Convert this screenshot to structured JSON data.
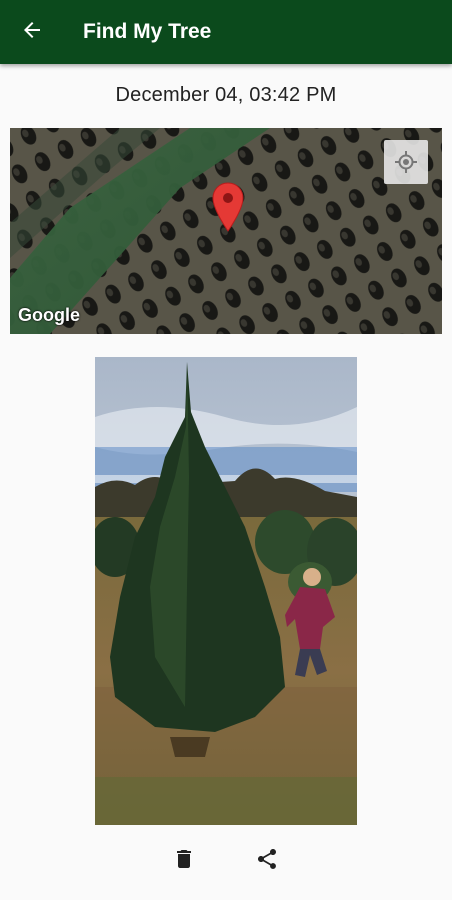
{
  "appbar": {
    "title": "Find My Tree",
    "back_icon": "arrow-back-icon",
    "background": "#0b4a1c"
  },
  "entry": {
    "timestamp": "December 04, 03:42 PM"
  },
  "map": {
    "attribution": "Google",
    "pin_icon": "map-pin-icon",
    "pin_color": "#e53935",
    "locate_icon": "my-location-icon"
  },
  "photo": {
    "subject": "tree-photo"
  },
  "actions": {
    "delete_icon": "delete-icon",
    "share_icon": "share-icon"
  }
}
